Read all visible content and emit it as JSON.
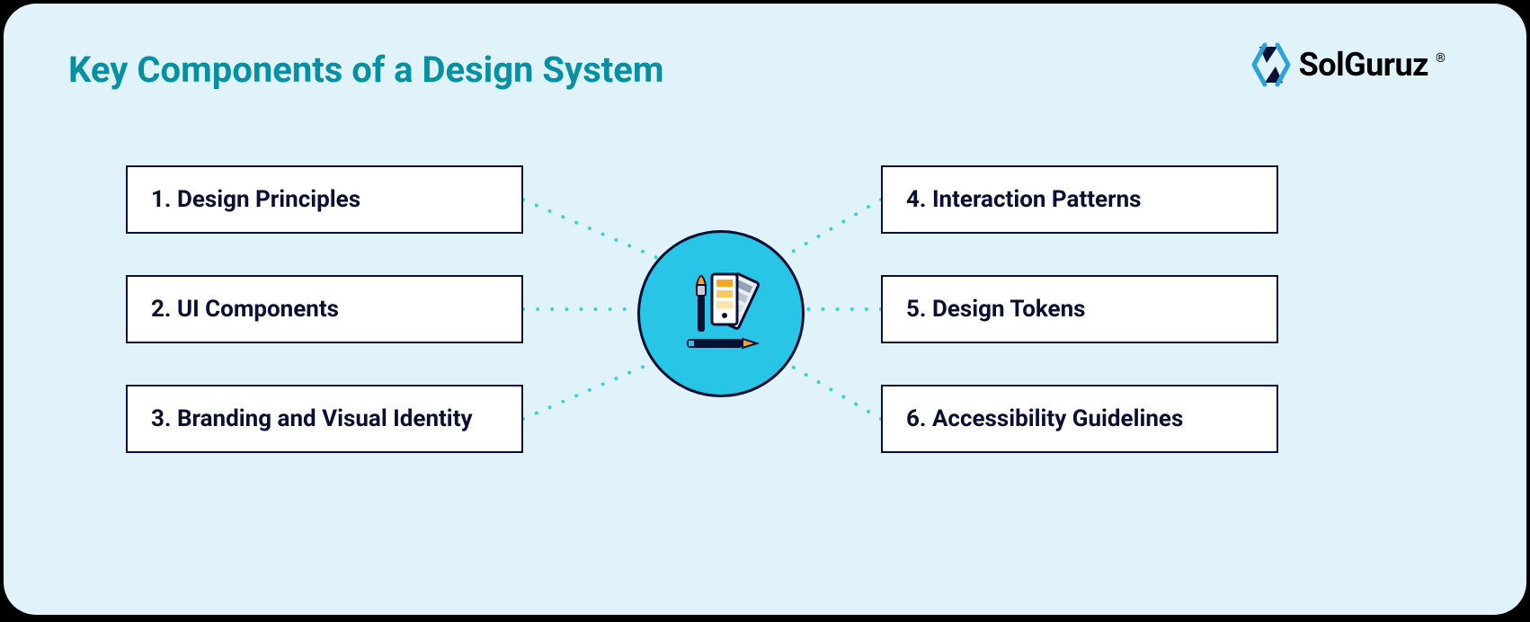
{
  "title": "Key Components of a Design System",
  "brand": {
    "name": "SolGuruz",
    "registered": "®"
  },
  "left": [
    {
      "num": "1.",
      "label": "Design Principles"
    },
    {
      "num": "2.",
      "label": "UI Components"
    },
    {
      "num": "3.",
      "label": "Branding and Visual Identity"
    }
  ],
  "right": [
    {
      "num": "4.",
      "label": "Interaction Patterns"
    },
    {
      "num": "5.",
      "label": "Design Tokens"
    },
    {
      "num": "6.",
      "label": "Accessibility Guidelines"
    }
  ],
  "colors": {
    "bg": "#E1F3FA",
    "title": "#0690A4",
    "ink": "#0A1033",
    "hub": "#29C5E6",
    "spoke": "#3DD0DF"
  }
}
